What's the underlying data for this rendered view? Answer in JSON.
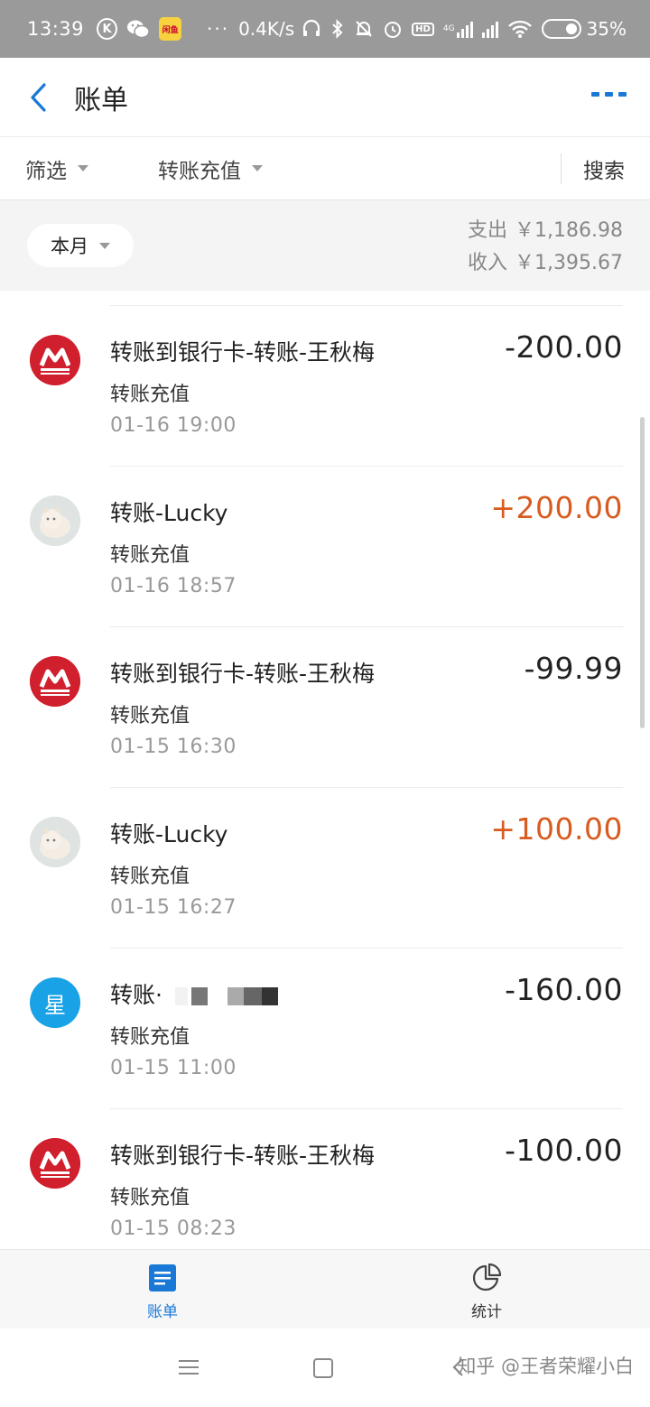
{
  "status_bar": {
    "time": "13:39",
    "speed": "0.4K/s",
    "battery": "35%",
    "k_icon": "K",
    "dots": "···",
    "app_badge": "闲鱼",
    "network": "4G",
    "hd": "HD"
  },
  "header": {
    "title": "账单"
  },
  "filters": {
    "all_label": "筛选",
    "type_label": "转账充值",
    "search_label": "搜索"
  },
  "summary": {
    "period": "本月",
    "expense_label": "支出",
    "expense_value": "￥1,186.98",
    "income_label": "收入",
    "income_value": "￥1,395.67"
  },
  "transactions": [
    {
      "name": "转账到银行卡-转账-王秋梅",
      "category": "转账充值",
      "time": "01-16  19:00",
      "amount": "-200.00",
      "direction": "out",
      "avatar": "cmb-logo-icon"
    },
    {
      "name": "转账-Lucky",
      "category": "转账充值",
      "time": "01-16  18:57",
      "amount": "+200.00",
      "direction": "in",
      "avatar": "cat-avatar"
    },
    {
      "name": "转账到银行卡-转账-王秋梅",
      "category": "转账充值",
      "time": "01-15  16:30",
      "amount": "-99.99",
      "direction": "out",
      "avatar": "cmb-logo-icon"
    },
    {
      "name": "转账-Lucky",
      "category": "转账充值",
      "time": "01-15  16:27",
      "amount": "+100.00",
      "direction": "in",
      "avatar": "cat-avatar"
    },
    {
      "name": "转账·",
      "category": "转账充值",
      "time": "01-15  11:00",
      "amount": "-160.00",
      "direction": "out",
      "avatar": "star-avatar",
      "avatar_text": "星"
    },
    {
      "name": "转账到银行卡-转账-王秋梅",
      "category": "转账充值",
      "time": "01-15  08:23",
      "amount": "-100.00",
      "direction": "out",
      "avatar": "cmb-logo-icon"
    }
  ],
  "tabs": {
    "bill_label": "账单",
    "stats_label": "统计"
  },
  "watermark": "知乎 @王者荣耀小白",
  "colors": {
    "accent": "#1a79d6",
    "income": "#d85b20",
    "cmb_red": "#d01f2d"
  }
}
